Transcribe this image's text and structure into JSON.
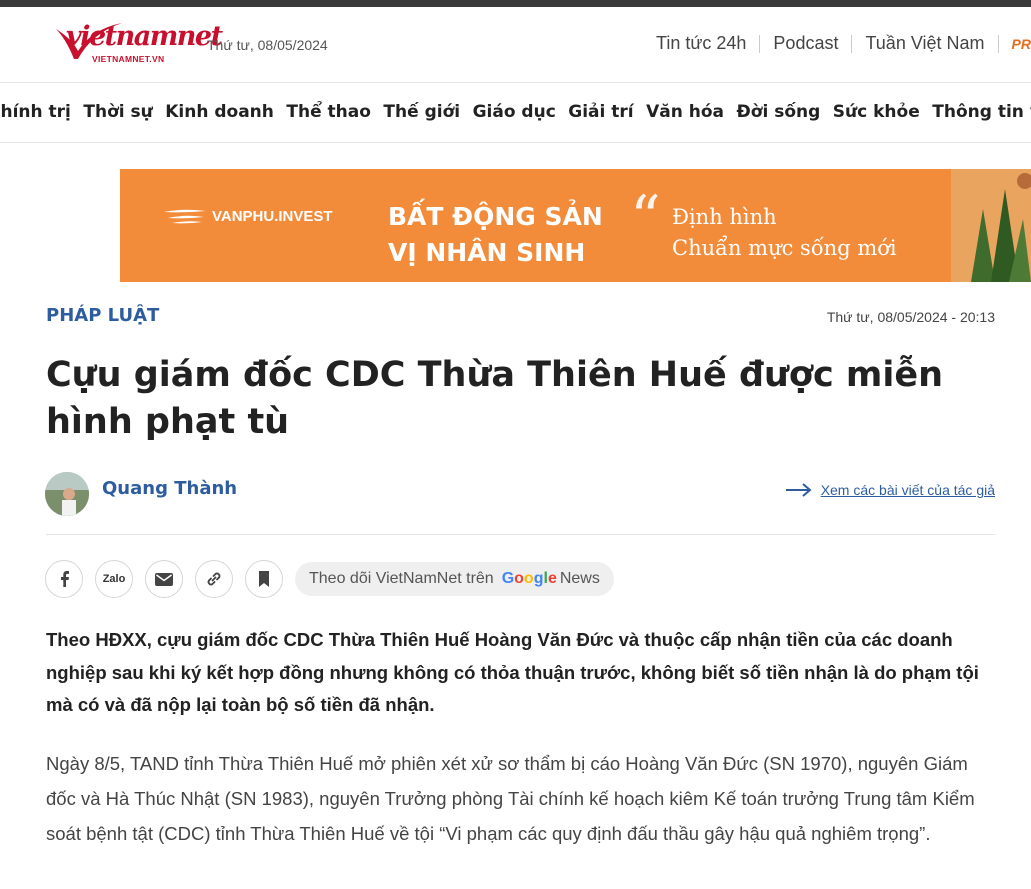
{
  "header": {
    "logo_text": "vietnamnet",
    "logo_sub": "VIETNAMNET.VN",
    "date": "Thứ tư, 08/05/2024",
    "links": [
      "Tin tức 24h",
      "Podcast",
      "Tuần Việt Nam",
      "PR"
    ]
  },
  "nav": {
    "items": [
      "Chính trị",
      "Thời sự",
      "Kinh doanh",
      "Thể thao",
      "Thế giới",
      "Giáo dục",
      "Giải trí",
      "Văn hóa",
      "Đời sống",
      "Sức khỏe",
      "Thông tin và Truyền thông"
    ]
  },
  "banner": {
    "brand": "VANPHU.INVEST",
    "headline_1": "BẤT ĐỘNG SẢN",
    "headline_2": "VỊ NHÂN SINH",
    "slogan_1": "Định hình",
    "slogan_2": "Chuẩn mực sống mới"
  },
  "article": {
    "category": "PHÁP LUẬT",
    "published": "Thứ tư, 08/05/2024 - 20:13",
    "title": "Cựu giám đốc CDC Thừa Thiên Huế được miễn hình phạt tù",
    "author": "Quang Thành",
    "author_link": "Xem các bài viết của tác giả",
    "follow_text": "Theo dõi VietNamNet trên",
    "follow_google": "Google",
    "follow_news": "News",
    "sapo": "Theo HĐXX, cựu giám đốc CDC Thừa Thiên Huế Hoàng Văn Đức và thuộc cấp nhận tiền của các doanh nghiệp sau khi ký kết hợp đồng nhưng không có thỏa thuận trước, không biết số tiền nhận là do phạm tội mà có và đã nộp lại toàn bộ số tiền đã nhận.",
    "paragraph_1": "Ngày 8/5, TAND tỉnh Thừa Thiên Huế mở phiên xét xử sơ thẩm bị cáo Hoàng Văn Đức (SN 1970), nguyên Giám đốc và Hà Thúc Nhật (SN 1983), nguyên Trưởng phòng Tài chính kế hoạch kiêm Kế toán trưởng Trung tâm Kiểm soát bệnh tật (CDC) tỉnh Thừa Thiên Huế về tội “Vi phạm các quy định đấu thầu gây hậu quả nghiêm trọng”."
  },
  "share": {
    "zalo_label": "Zalo"
  },
  "colors": {
    "brand_red": "#c8102e",
    "link_blue": "#2d5d9f",
    "banner_orange": "#f28c3b",
    "pr_orange": "#e36f1e"
  }
}
